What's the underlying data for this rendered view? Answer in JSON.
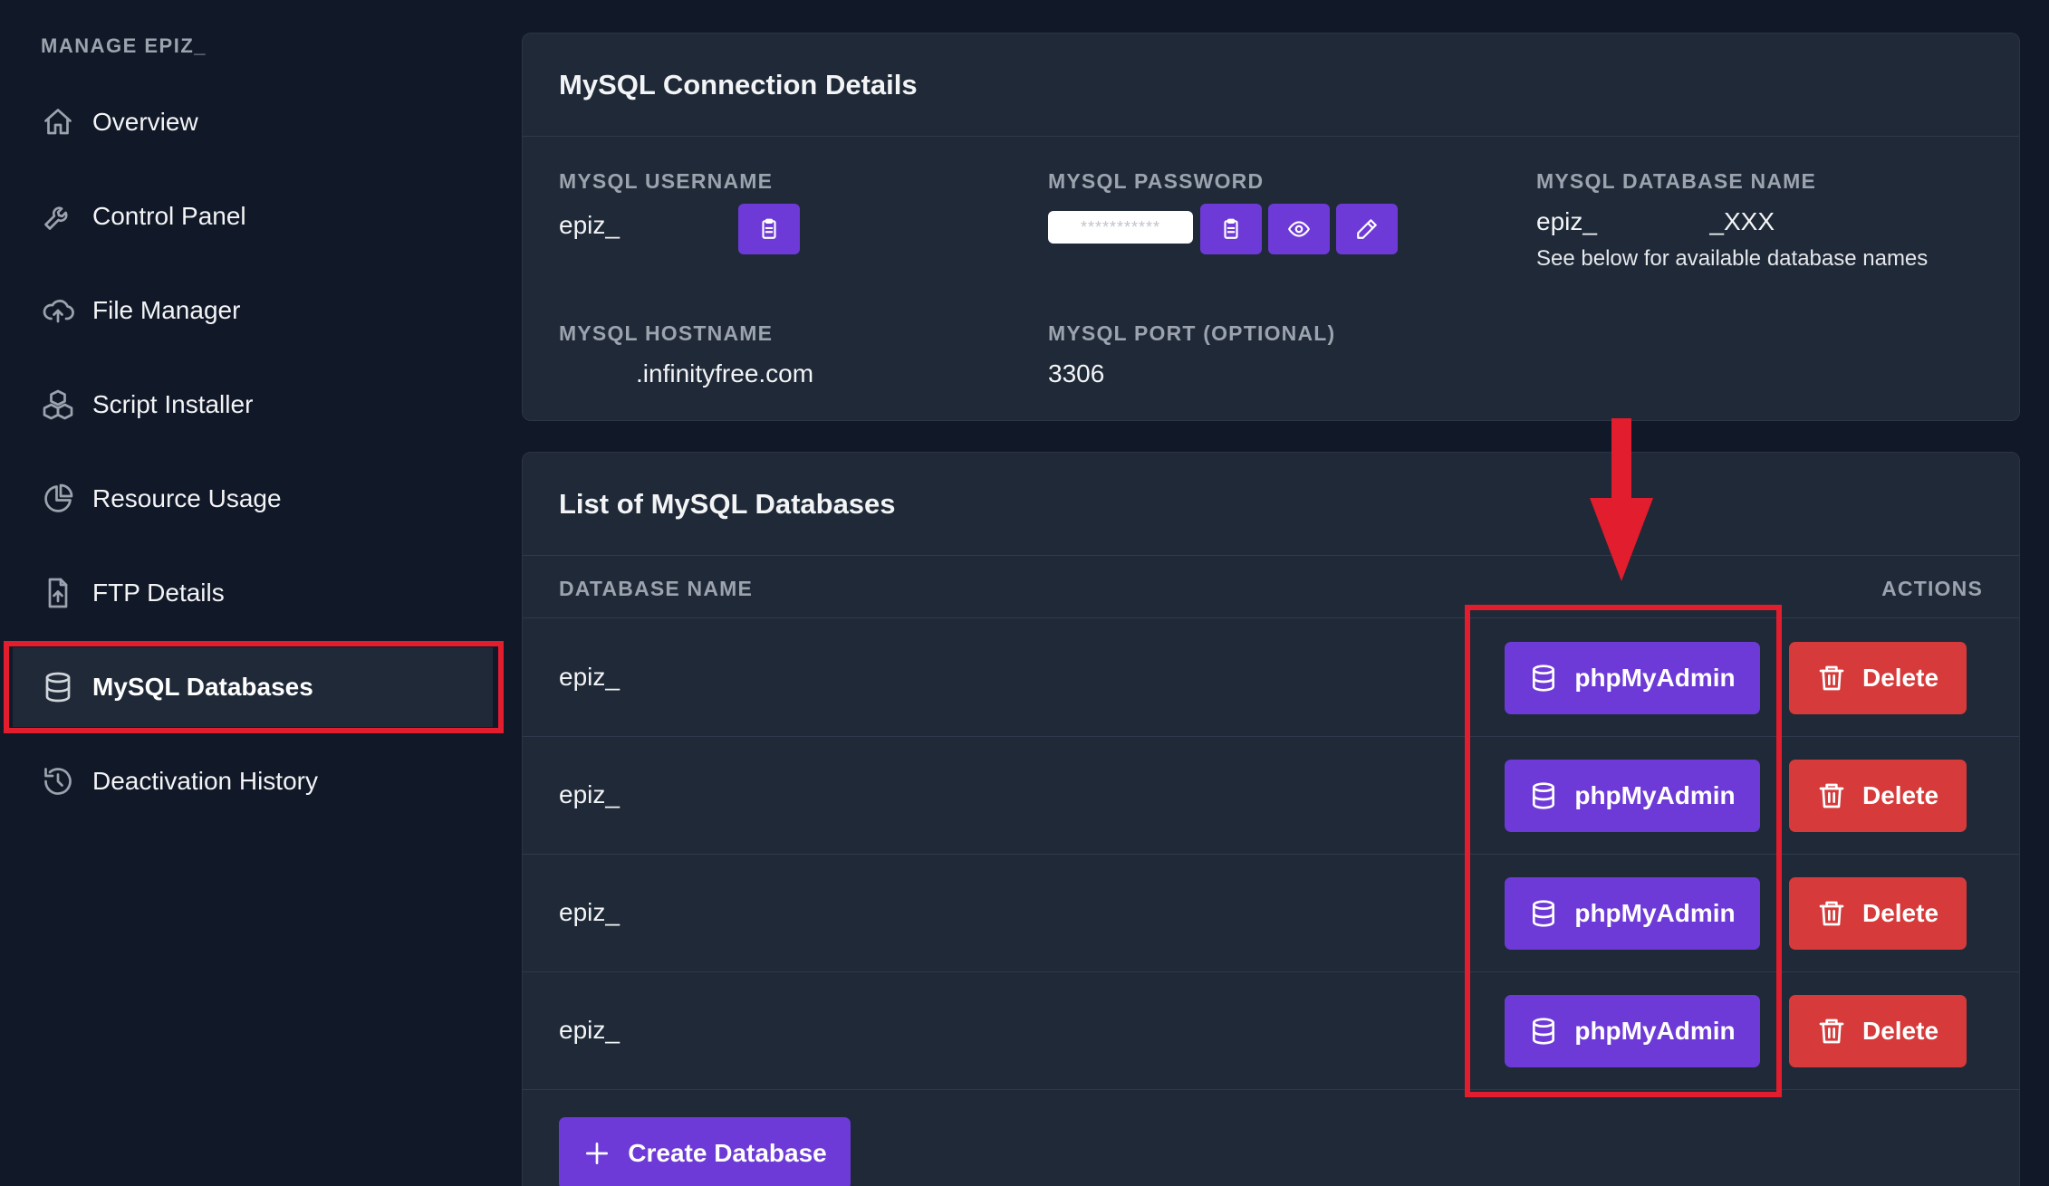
{
  "sidebar": {
    "title": "MANAGE EPIZ_",
    "items": [
      {
        "label": "Overview",
        "icon": "home-icon"
      },
      {
        "label": "Control Panel",
        "icon": "wrench-icon"
      },
      {
        "label": "File Manager",
        "icon": "cloud-upload-icon"
      },
      {
        "label": "Script Installer",
        "icon": "cubes-icon"
      },
      {
        "label": "Resource Usage",
        "icon": "pie-chart-icon"
      },
      {
        "label": "FTP Details",
        "icon": "file-upload-icon"
      },
      {
        "label": "MySQL Databases",
        "icon": "database-icon",
        "active": true
      },
      {
        "label": "Deactivation History",
        "icon": "history-icon"
      }
    ]
  },
  "connection": {
    "title": "MySQL Connection Details",
    "username_label": "MYSQL USERNAME",
    "username_value": "epiz_",
    "password_label": "MYSQL PASSWORD",
    "password_value": "***********",
    "dbname_label": "MYSQL DATABASE NAME",
    "dbname_value": "epiz_                _XXX",
    "dbname_note": "See below for available database names",
    "hostname_label": "MYSQL HOSTNAME",
    "hostname_value": ".infinityfree.com",
    "port_label": "MYSQL PORT (OPTIONAL)",
    "port_value": "3306"
  },
  "databases": {
    "title": "List of MySQL Databases",
    "col_name": "DATABASE NAME",
    "col_actions": "ACTIONS",
    "rows": [
      {
        "name": "epiz_"
      },
      {
        "name": "epiz_"
      },
      {
        "name": "epiz_"
      },
      {
        "name": "epiz_"
      }
    ],
    "phpmyadmin_label": "phpMyAdmin",
    "delete_label": "Delete",
    "create_label": "Create Database"
  },
  "colors": {
    "accent_purple": "#6d3ad7",
    "danger_red": "#d63a3a",
    "highlight_red": "#e11d2e"
  }
}
